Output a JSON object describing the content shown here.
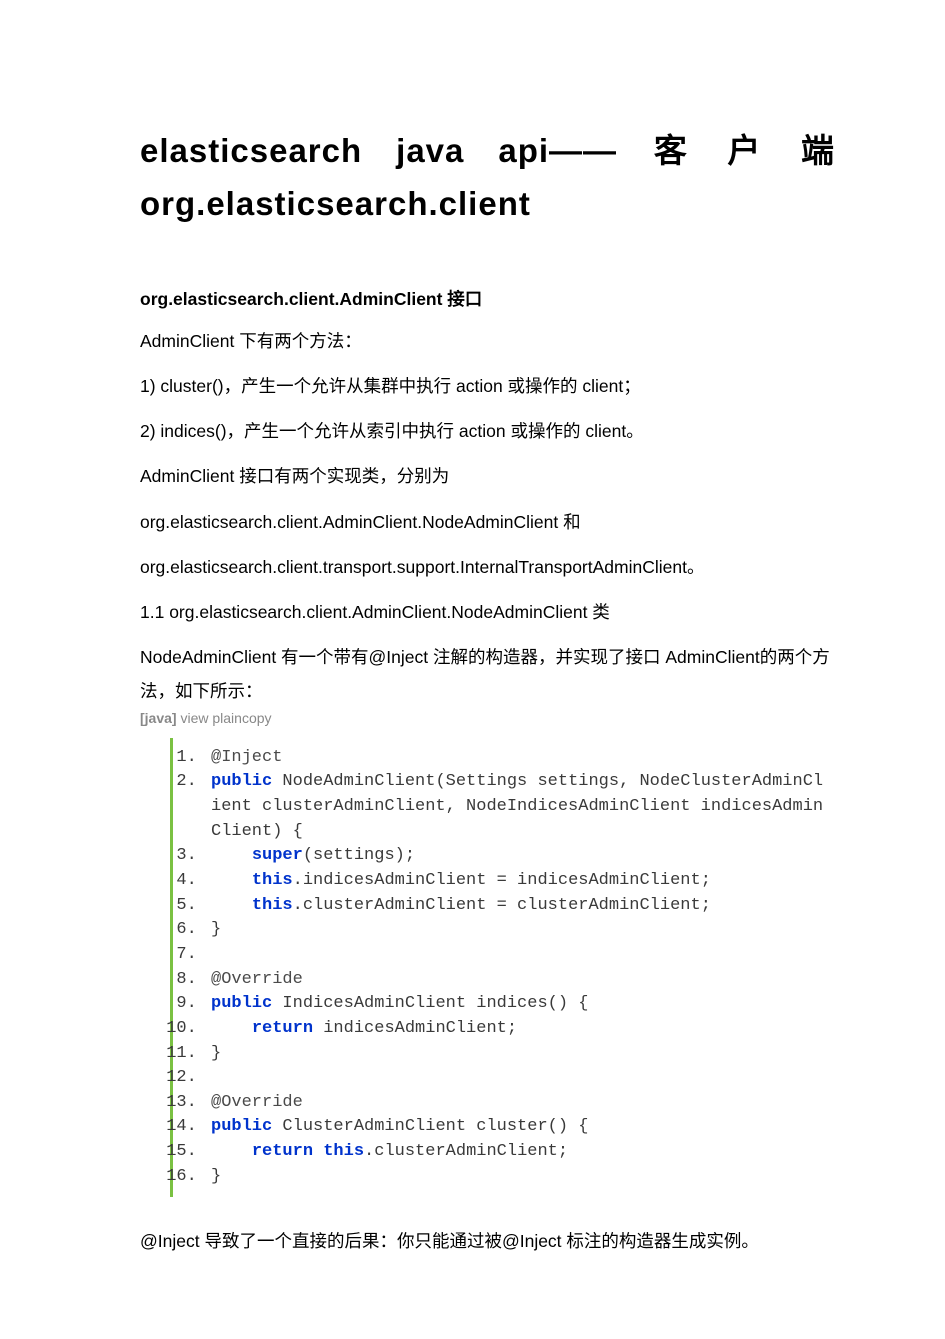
{
  "title_line1": "elasticsearch java api—— 客 户 端",
  "title_line2": "org.elasticsearch.client",
  "section_heading": "org.elasticsearch.client.AdminClient 接口",
  "paragraphs": {
    "p1": "AdminClient 下有两个方法：",
    "p2": "1) cluster()，产生一个允许从集群中执行 action 或操作的 client；",
    "p3": "2) indices()，产生一个允许从索引中执行 action 或操作的 client。",
    "p4": "AdminClient 接口有两个实现类，分别为",
    "p5": "org.elasticsearch.client.AdminClient.NodeAdminClient 和",
    "p6": "org.elasticsearch.client.transport.support.InternalTransportAdminClient。",
    "p7": "1.1 org.elasticsearch.client.AdminClient.NodeAdminClient 类",
    "p8": "NodeAdminClient 有一个带有@Inject 注解的构造器，并实现了接口 AdminClient的两个方法，如下所示：",
    "post": "@Inject 导致了一个直接的后果：你只能通过被@Inject 标注的构造器生成实例。"
  },
  "code_meta": {
    "label": "[java]",
    "actions": " view plaincopy"
  },
  "code_lines": [
    {
      "segments": [
        {
          "cls": "ann",
          "t": "@Inject"
        }
      ]
    },
    {
      "segments": [
        {
          "cls": "kw",
          "t": "public"
        },
        {
          "cls": "plain",
          "t": " NodeAdminClient(Settings settings, NodeClusterAdminClient clusterAdminClient, NodeIndicesAdminClient indicesAdminClient) {"
        }
      ]
    },
    {
      "segments": [
        {
          "cls": "plain",
          "t": "    "
        },
        {
          "cls": "kw",
          "t": "super"
        },
        {
          "cls": "plain",
          "t": "(settings);"
        }
      ]
    },
    {
      "segments": [
        {
          "cls": "plain",
          "t": "    "
        },
        {
          "cls": "kw",
          "t": "this"
        },
        {
          "cls": "plain",
          "t": ".indicesAdminClient = indicesAdminClient;"
        }
      ]
    },
    {
      "segments": [
        {
          "cls": "plain",
          "t": "    "
        },
        {
          "cls": "kw",
          "t": "this"
        },
        {
          "cls": "plain",
          "t": ".clusterAdminClient = clusterAdminClient;"
        }
      ]
    },
    {
      "segments": [
        {
          "cls": "plain",
          "t": "}"
        }
      ]
    },
    {
      "segments": []
    },
    {
      "segments": [
        {
          "cls": "ann",
          "t": "@Override"
        }
      ]
    },
    {
      "segments": [
        {
          "cls": "kw",
          "t": "public"
        },
        {
          "cls": "plain",
          "t": " IndicesAdminClient indices() {"
        }
      ]
    },
    {
      "segments": [
        {
          "cls": "plain",
          "t": "    "
        },
        {
          "cls": "kw",
          "t": "return"
        },
        {
          "cls": "plain",
          "t": " indicesAdminClient;"
        }
      ]
    },
    {
      "segments": [
        {
          "cls": "plain",
          "t": "}"
        }
      ]
    },
    {
      "segments": []
    },
    {
      "segments": [
        {
          "cls": "ann",
          "t": "@Override"
        }
      ]
    },
    {
      "segments": [
        {
          "cls": "kw",
          "t": "public"
        },
        {
          "cls": "plain",
          "t": " ClusterAdminClient cluster() {"
        }
      ]
    },
    {
      "segments": [
        {
          "cls": "plain",
          "t": "    "
        },
        {
          "cls": "kw",
          "t": "return"
        },
        {
          "cls": "plain",
          "t": " "
        },
        {
          "cls": "kw",
          "t": "this"
        },
        {
          "cls": "plain",
          "t": ".clusterAdminClient;"
        }
      ]
    },
    {
      "segments": [
        {
          "cls": "plain",
          "t": "}"
        }
      ]
    }
  ]
}
